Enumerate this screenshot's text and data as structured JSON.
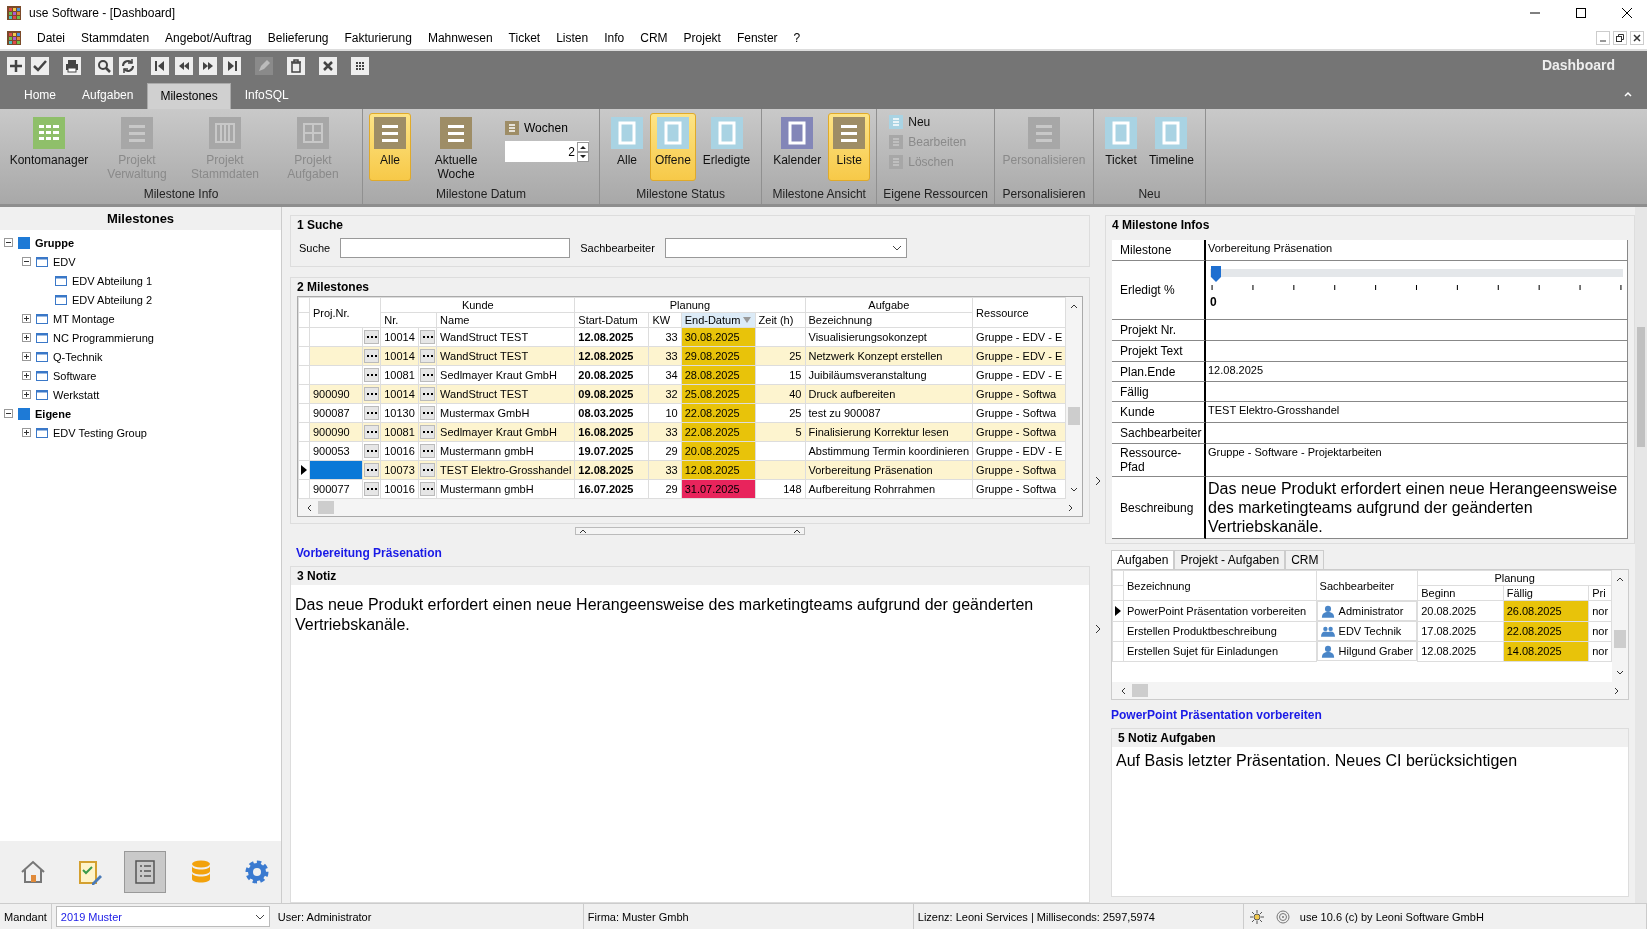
{
  "window": {
    "title": "use Software - [Dashboard]"
  },
  "menu": [
    "Datei",
    "Stammdaten",
    "Angebot/Auftrag",
    "Belieferung",
    "Fakturierung",
    "Mahnwesen",
    "Ticket",
    "Listen",
    "Info",
    "CRM",
    "Projekt",
    "Fenster",
    "?"
  ],
  "ribbon_tabs": [
    {
      "label": "Home",
      "selected": false
    },
    {
      "label": "Aufgaben",
      "selected": false
    },
    {
      "label": "Milestones",
      "selected": true
    },
    {
      "label": "InfoSQL",
      "selected": false
    }
  ],
  "ribbon_title": "Dashboard",
  "ribbon_groups": [
    {
      "label": "Milestone Info",
      "items": [
        {
          "kind": "grid",
          "label": "Kontomanager",
          "color": "#8fbf6a",
          "selected": false,
          "disabled": false
        },
        {
          "kind": "lines",
          "label": "Projekt Verwaltung",
          "color": "#a7a7a7",
          "selected": false,
          "disabled": true
        },
        {
          "kind": "bars",
          "label": "Projekt Stammdaten",
          "color": "#a7a7a7",
          "selected": false,
          "disabled": true
        },
        {
          "kind": "tiles",
          "label": "Projekt Aufgaben",
          "color": "#a7a7a7",
          "selected": false,
          "disabled": true
        }
      ]
    },
    {
      "label": "Milestone Datum",
      "items": [
        {
          "kind": "lines",
          "label": "Alle",
          "color": "#9e8d66",
          "selected": true,
          "disabled": false
        },
        {
          "kind": "lines",
          "label": "Aktuelle Woche",
          "color": "#9e8d66",
          "selected": false,
          "disabled": false
        },
        {
          "kind": "spin",
          "label": "Wochen",
          "color": "#9e8d66",
          "value": "2"
        }
      ]
    },
    {
      "label": "Milestone Status",
      "items": [
        {
          "kind": "frame",
          "label": "Alle",
          "color": "#a9d3e3",
          "selected": false,
          "disabled": false
        },
        {
          "kind": "frame",
          "label": "Offene",
          "color": "#a9d3e3",
          "selected": true,
          "disabled": false
        },
        {
          "kind": "frame",
          "label": "Erledigte",
          "color": "#a9d3e3",
          "selected": false,
          "disabled": false
        }
      ]
    },
    {
      "label": "Milestone Ansicht",
      "items": [
        {
          "kind": "frame",
          "label": "Kalender",
          "color": "#8386b8",
          "selected": false,
          "disabled": false
        },
        {
          "kind": "lines",
          "label": "Liste",
          "color": "#9e8d66",
          "selected": true,
          "disabled": false
        }
      ]
    },
    {
      "label": "Eigene Ressourcen",
      "items": [
        {
          "kind": "small",
          "label": "Neu",
          "color": "#a9d3e3",
          "disabled": false
        },
        {
          "kind": "small",
          "label": "Bearbeiten",
          "color": "#a7a7a7",
          "disabled": true
        },
        {
          "kind": "small",
          "label": "Löschen",
          "color": "#a7a7a7",
          "disabled": true
        }
      ]
    },
    {
      "label": "Personalisieren",
      "items": [
        {
          "kind": "lines",
          "label": "Personalisieren",
          "color": "#a7a7a7",
          "selected": false,
          "disabled": true
        }
      ]
    },
    {
      "label": "Neu",
      "items": [
        {
          "kind": "frame",
          "label": "Ticket",
          "color": "#a9d3e3",
          "selected": false,
          "disabled": false
        },
        {
          "kind": "frame",
          "label": "Timeline",
          "color": "#a9d3e3",
          "selected": false,
          "disabled": false
        }
      ]
    }
  ],
  "tree": {
    "title": "Milestones",
    "nodes": [
      {
        "label": "Gruppe",
        "kind": "root",
        "expanded": true,
        "children": [
          {
            "label": "EDV",
            "kind": "group",
            "expanded": true,
            "children": [
              {
                "label": "EDV Abteilung 1",
                "kind": "group"
              },
              {
                "label": "EDV Abteilung 2",
                "kind": "group"
              }
            ]
          },
          {
            "label": "MT Montage",
            "kind": "group",
            "expanded": false
          },
          {
            "label": "NC Programmierung",
            "kind": "group",
            "expanded": false
          },
          {
            "label": "Q-Technik",
            "kind": "group",
            "expanded": false
          },
          {
            "label": "Software",
            "kind": "group",
            "expanded": false
          },
          {
            "label": "Werkstatt",
            "kind": "group",
            "expanded": false
          }
        ]
      },
      {
        "label": "Eigene",
        "kind": "root",
        "expanded": true,
        "children": [
          {
            "label": "EDV Testing Group",
            "kind": "group",
            "expanded": false
          }
        ]
      }
    ]
  },
  "nav": [
    {
      "kind": "home",
      "selected": false
    },
    {
      "kind": "tasks",
      "selected": false
    },
    {
      "kind": "list",
      "selected": true
    },
    {
      "kind": "database",
      "selected": false
    },
    {
      "kind": "settings",
      "selected": false
    }
  ],
  "search": {
    "heading": "1 Suche",
    "search_label": "Suche",
    "owner_label": "Sachbearbeiter"
  },
  "milestones": {
    "heading": "2 Milestones",
    "group_headers": [
      "Kunde",
      "Planung",
      "Aufgabe"
    ],
    "columns": [
      "Proj.Nr.",
      "Nr.",
      "Name",
      "Start-Datum",
      "KW",
      "End-Datum",
      "Zeit (h)",
      "Bezeichnung",
      "Ressource"
    ],
    "rows": [
      {
        "nr": "10014",
        "name": "WandStruct TEST",
        "start": "12.08.2025",
        "kw": "33",
        "end": "30.08.2025",
        "color": "#e8c30a",
        "task": "Visualisierungsokonzept",
        "resource": "Gruppe - EDV - E",
        "selected": false
      },
      {
        "nr": "10014",
        "name": "WandStruct TEST",
        "start": "12.08.2025",
        "kw": "33",
        "end": "29.08.2025",
        "color": "#e8c30a",
        "hours": "25",
        "task": "Netzwerk Konzept erstellen",
        "resource": "Gruppe - EDV - E",
        "selected": false
      },
      {
        "nr": "10081",
        "name": "Sedlmayer Kraut GmbH",
        "start": "20.08.2025",
        "kw": "34",
        "end": "28.08.2025",
        "color": "#e8c30a",
        "hours": "15",
        "task": "Juibiläumsveranstaltung",
        "resource": "Gruppe - EDV - E",
        "selected": false
      },
      {
        "proj": "900090",
        "nr": "10014",
        "name": "WandStruct TEST",
        "start": "09.08.2025",
        "kw": "32",
        "end": "25.08.2025",
        "color": "#e8c30a",
        "hours": "40",
        "task": "Druck aufbereiten",
        "resource": "Gruppe - Softwa",
        "selected": false
      },
      {
        "proj": "900087",
        "nr": "10130",
        "name": "Mustermax GmbH",
        "start": "08.03.2025",
        "kw": "10",
        "end": "22.08.2025",
        "color": "#e8c30a",
        "hours": "25",
        "task": "test zu 900087",
        "resource": "Gruppe - Softwa",
        "selected": false
      },
      {
        "proj": "900090",
        "nr": "10081",
        "name": "Sedlmayer Kraut GmbH",
        "start": "16.08.2025",
        "kw": "33",
        "end": "22.08.2025",
        "color": "#e8c30a",
        "hours": "5",
        "task": "Finalisierung Korrektur lesen",
        "resource": "Gruppe - Softwa",
        "selected": false
      },
      {
        "proj": "900053",
        "nr": "10016",
        "name": "Mustermann gmbH",
        "start": "19.07.2025",
        "kw": "29",
        "end": "20.08.2025",
        "color": "#e8c30a",
        "task": "Abstimmung Termin koordinieren",
        "resource": "Gruppe - EDV - E",
        "selected": false
      },
      {
        "nr": "10073",
        "name": "TEST Elektro-Grosshandel",
        "start": "12.08.2025",
        "kw": "33",
        "end": "12.08.2025",
        "color": "#e8c30a",
        "task": "Vorbereitung Präsenation",
        "resource": "Gruppe - Softwa",
        "selected": true
      },
      {
        "proj": "900077",
        "nr": "10016",
        "name": "Mustermann gmbH",
        "start": "16.07.2025",
        "kw": "29",
        "end": "31.07.2025",
        "color": "#e8245c",
        "hours": "148",
        "task": "Aufbereitung Rohrrahmen",
        "resource": "Gruppe - Softwa",
        "selected": false
      }
    ]
  },
  "selected_title": "Vorbereitung Präsenation",
  "note": {
    "heading": "3 Notiz",
    "text": "Das neue Produkt erfordert einen neue Herangeensweise des marketingteams aufgrund der geänderten Vertriebskanäle."
  },
  "info": {
    "heading": "4 Milestone Infos",
    "fields": [
      {
        "kind": "text",
        "label": "Milestone",
        "value": "Vorbereitung Präsenation"
      },
      {
        "kind": "slider",
        "label": "Erledigt %",
        "level": 0,
        "reading": "0"
      },
      {
        "kind": "text",
        "label": "Projekt Nr."
      },
      {
        "kind": "text",
        "label": "Projekt Text"
      },
      {
        "kind": "text",
        "label": "Plan.Ende",
        "value": "12.08.2025"
      },
      {
        "kind": "text",
        "label": "Fällig"
      },
      {
        "kind": "text",
        "label": "Kunde",
        "value": "TEST Elektro-Grosshandel"
      },
      {
        "kind": "text",
        "label": "Sachbearbeiter"
      },
      {
        "kind": "text",
        "label": "Ressource-Pfad",
        "value": "Gruppe - Software - Projektarbeiten"
      },
      {
        "kind": "memo",
        "label": "Beschreibung",
        "value": "Das neue Produkt erfordert einen neue Herangeensweise des marketingteams aufgrund der geänderten Vertriebskanäle."
      }
    ]
  },
  "task_tabs": [
    {
      "label": "Aufgaben",
      "selected": true
    },
    {
      "label": "Projekt - Aufgaben",
      "selected": false
    },
    {
      "label": "CRM",
      "selected": false
    }
  ],
  "tasks": {
    "group_header": "Planung",
    "columns": [
      "Bezeichnung",
      "Sachbearbeiter",
      "Beginn",
      "Fällig",
      "Pri"
    ],
    "rows": [
      {
        "name": "PowerPoint Präsentation vorbereiten",
        "owner": "Administrator",
        "kind": "user",
        "begin": "20.08.2025",
        "due": "26.08.2025",
        "prio": "nor",
        "selected": true
      },
      {
        "name": "Erstellen Produktbeschreibung",
        "owner": "EDV Technik",
        "kind": "group",
        "begin": "17.08.2025",
        "due": "22.08.2025",
        "prio": "nor",
        "selected": false
      },
      {
        "name": "Erstellen Sujet für Einladungen",
        "owner": "Hilgund Graber",
        "kind": "user",
        "begin": "12.08.2025",
        "due": "14.08.2025",
        "prio": "nor",
        "selected": false
      }
    ]
  },
  "task_title": "PowerPoint Präsentation vorbereiten",
  "task_note": {
    "heading": "5 Notiz Aufgaben",
    "text": "Auf Basis letzter Präsentation. Neues CI berücksichtigen"
  },
  "status_bar": {
    "mandant_label": "Mandant",
    "mandant": "2019 Muster",
    "user": "User: Administrator",
    "firma": "Firma: Muster Gmbh",
    "lizenz": "Lizenz: Leoni Services | Milliseconds: 2597,5974",
    "version": "use 10.6 (c) by Leoni Software GmbH"
  }
}
